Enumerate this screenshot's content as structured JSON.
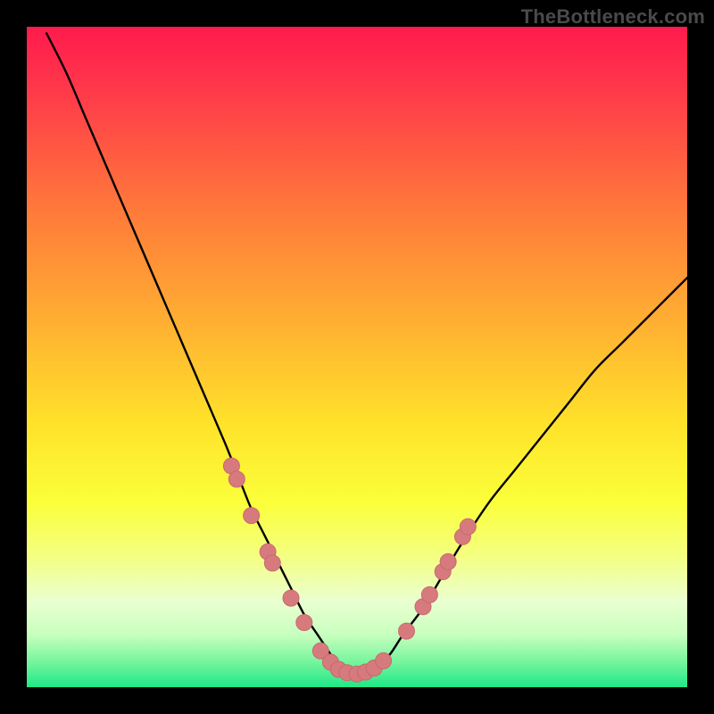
{
  "watermark": "TheBottleneck.com",
  "colors": {
    "frame": "#000000",
    "curve": "#000000",
    "marker_fill": "#d77a7e",
    "marker_stroke": "#c76a6f",
    "gradient_stops": [
      {
        "offset": 0.0,
        "color": "#ff1a4d"
      },
      {
        "offset": 0.1,
        "color": "#ff3a4a"
      },
      {
        "offset": 0.28,
        "color": "#ff7a3a"
      },
      {
        "offset": 0.45,
        "color": "#ffb032"
      },
      {
        "offset": 0.6,
        "color": "#ffe22a"
      },
      {
        "offset": 0.72,
        "color": "#fbff3a"
      },
      {
        "offset": 0.8,
        "color": "#f4ff80"
      },
      {
        "offset": 0.87,
        "color": "#eaffd0"
      },
      {
        "offset": 0.92,
        "color": "#c8ffbf"
      },
      {
        "offset": 0.96,
        "color": "#7af59e"
      },
      {
        "offset": 1.0,
        "color": "#1fe887"
      }
    ]
  },
  "chart_data": {
    "type": "line",
    "title": "",
    "xlabel": "",
    "ylabel": "",
    "xlim": [
      0,
      100
    ],
    "ylim": [
      0,
      100
    ],
    "grid": false,
    "legend": false,
    "series": [
      {
        "name": "bottleneck-curve",
        "x": [
          3,
          6,
          9,
          12,
          15,
          18,
          21,
          24,
          27,
          30,
          32,
          34,
          36,
          38,
          40,
          42,
          44,
          46,
          47,
          48,
          49,
          51,
          53,
          55,
          57,
          60,
          63,
          66,
          70,
          74,
          78,
          82,
          86,
          90,
          94,
          98,
          100
        ],
        "y": [
          99,
          93,
          86,
          79,
          72,
          65,
          58,
          51,
          44,
          37,
          32,
          27,
          23,
          19,
          15,
          11,
          8,
          5,
          3.5,
          2.5,
          2,
          2.2,
          3,
          5,
          8,
          12,
          17,
          22,
          28,
          33,
          38,
          43,
          48,
          52,
          56,
          60,
          62
        ]
      }
    ],
    "markers": [
      {
        "x": 31.0,
        "y": 33.5
      },
      {
        "x": 31.8,
        "y": 31.5
      },
      {
        "x": 34.0,
        "y": 26.0
      },
      {
        "x": 36.5,
        "y": 20.5
      },
      {
        "x": 37.2,
        "y": 18.8
      },
      {
        "x": 40.0,
        "y": 13.5
      },
      {
        "x": 42.0,
        "y": 9.8
      },
      {
        "x": 44.5,
        "y": 5.5
      },
      {
        "x": 46.0,
        "y": 3.8
      },
      {
        "x": 47.2,
        "y": 2.7
      },
      {
        "x": 48.5,
        "y": 2.2
      },
      {
        "x": 50.0,
        "y": 2.0
      },
      {
        "x": 51.3,
        "y": 2.3
      },
      {
        "x": 52.6,
        "y": 2.9
      },
      {
        "x": 54.0,
        "y": 4.0
      },
      {
        "x": 57.5,
        "y": 8.5
      },
      {
        "x": 60.0,
        "y": 12.2
      },
      {
        "x": 61.0,
        "y": 14.0
      },
      {
        "x": 63.0,
        "y": 17.5
      },
      {
        "x": 63.8,
        "y": 19.0
      },
      {
        "x": 66.0,
        "y": 22.8
      },
      {
        "x": 66.8,
        "y": 24.3
      }
    ]
  }
}
